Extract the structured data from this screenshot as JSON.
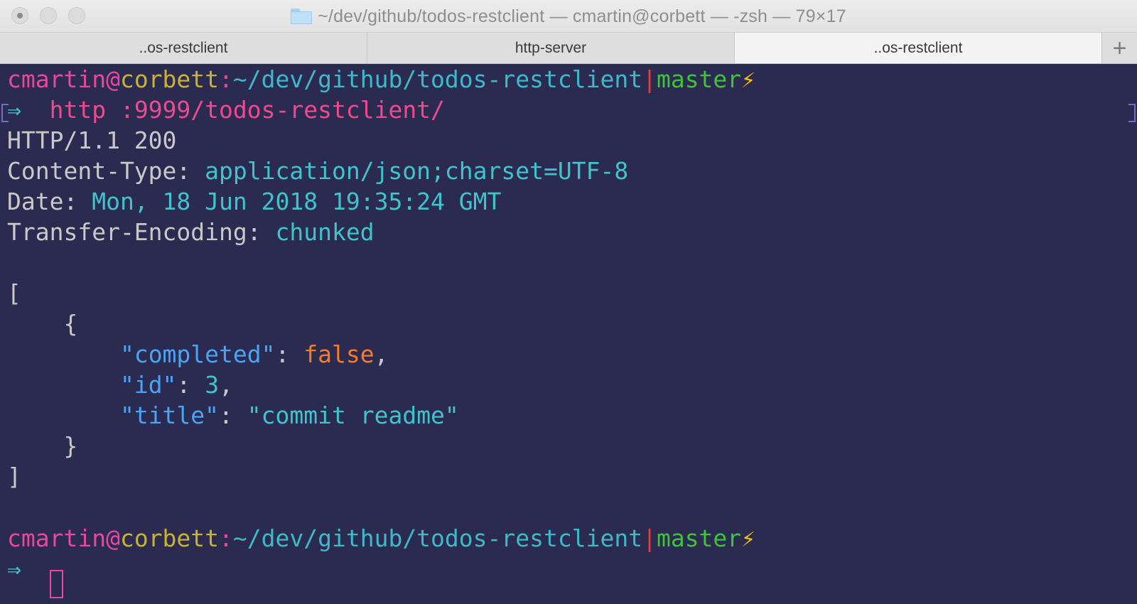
{
  "window": {
    "title": "~/dev/github/todos-restclient — cmartin@corbett — -zsh — 79×17",
    "folder_icon": "folder-icon"
  },
  "tabs": [
    {
      "label": "..os-restclient",
      "active": false
    },
    {
      "label": "http-server",
      "active": false
    },
    {
      "label": "..os-restclient",
      "active": true
    }
  ],
  "tab_add_label": "+",
  "prompt": {
    "user": "cmartin",
    "at": "@",
    "host": "corbett",
    "colon": ":",
    "path": "~/dev/github/todos-restclient",
    "pipe": "|",
    "branch": "master",
    "bolt": "⚡",
    "arrow": "⇒"
  },
  "command": "http :9999/todos-restclient/",
  "response": {
    "status_line": "HTTP/1.1 200",
    "headers": [
      {
        "name": "Content-Type:",
        "value": "application/json;charset=UTF-8"
      },
      {
        "name": "Date:",
        "value": "Mon, 18 Jun 2018 19:35:24 GMT"
      },
      {
        "name": "Transfer-Encoding:",
        "value": "chunked"
      }
    ],
    "body": {
      "open_bracket": "[",
      "open_brace": "{",
      "fields": [
        {
          "key": "\"completed\"",
          "sep": ": ",
          "value": "false",
          "trail": ","
        },
        {
          "key": "\"id\"",
          "sep": ": ",
          "value": "3",
          "trail": ","
        },
        {
          "key": "\"title\"",
          "sep": ": ",
          "value": "\"commit readme\"",
          "trail": ""
        }
      ],
      "close_brace": "}",
      "close_bracket": "]"
    }
  },
  "colors": {
    "terminal_bg": "#2b2a50",
    "user": "#e7489a",
    "host": "#c9b32f",
    "path": "#3fb8c8",
    "branch": "#40c23a",
    "bolt": "#f4c017",
    "command": "#f04a8e",
    "json_key": "#4aa4f6",
    "json_false": "#f57d2a"
  }
}
